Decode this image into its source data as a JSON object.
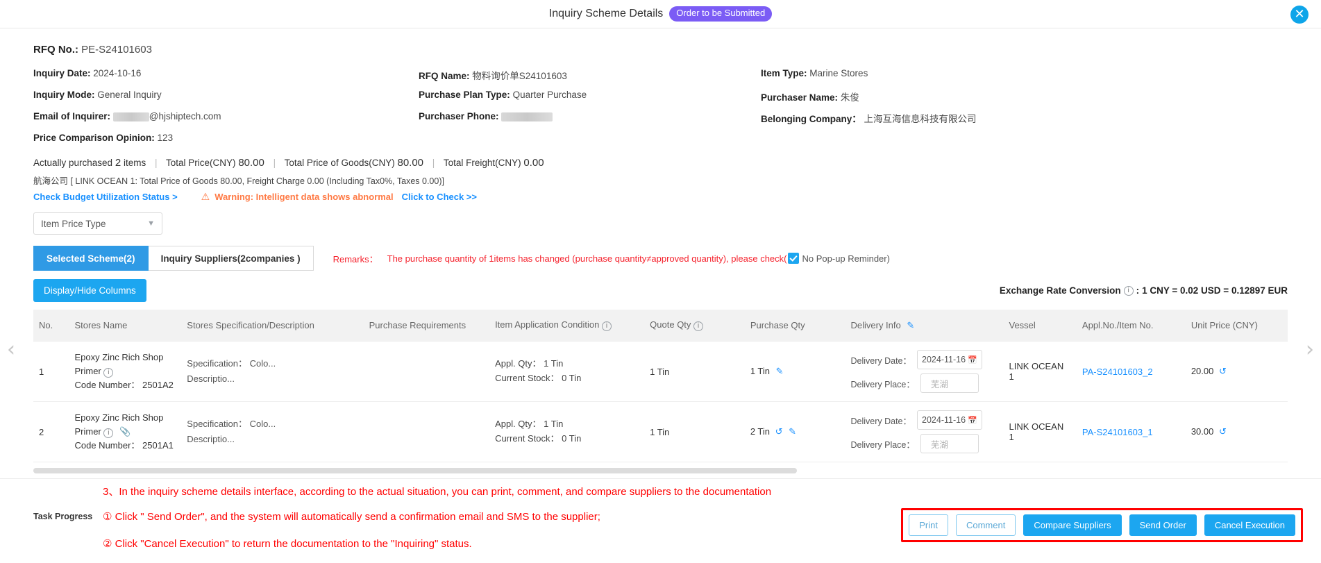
{
  "titlebar": {
    "title": "Inquiry Scheme Details",
    "status": "Order to be Submitted",
    "close": "✕"
  },
  "header": {
    "rfq_no_label": "RFQ No.:",
    "rfq_no_value": "PE-S24101603",
    "fields": [
      {
        "label": "Inquiry Date:",
        "value": "2024-10-16"
      },
      {
        "label": "RFQ Name:",
        "value": "物料询价单S24101603"
      },
      {
        "label": "Item Type:",
        "value": "Marine Stores"
      },
      {
        "label": "Inquiry Mode:",
        "value": "General Inquiry"
      },
      {
        "label": "Purchase Plan Type:",
        "value": "Quarter Purchase"
      },
      {
        "label": "Purchaser Name:",
        "value": "朱俊"
      },
      {
        "label": "Email of Inquirer:",
        "value": "@hjshiptech.com"
      },
      {
        "label": "Purchaser Phone:",
        "value": ""
      },
      {
        "label": "Belonging Company：",
        "value": "上海互海信息科技有限公司"
      },
      {
        "label": "Price Comparison Opinion:",
        "value": "123"
      }
    ]
  },
  "summary": {
    "purchased_prefix": "Actually purchased",
    "purchased_count": "2",
    "purchased_suffix": "items",
    "total_price_label": "Total Price(CNY)",
    "total_price_value": "80.00",
    "total_goods_label": "Total Price of Goods(CNY)",
    "total_goods_value": "80.00",
    "total_freight_label": "Total Freight(CNY)",
    "total_freight_value": "0.00",
    "supplier_line": "航海公司 [ LINK OCEAN 1: Total Price of Goods 80.00, Freight Charge 0.00 (Including Tax0%, Taxes 0.00)]",
    "budget_link": "Check Budget Utilization Status >",
    "warning_text": "Warning: Intelligent data shows abnormal",
    "warning_link": "Click to Check >>",
    "warning_icon": "⚠"
  },
  "price_type_select": {
    "value": "Item Price Type",
    "chevron": "⌄"
  },
  "tabs": [
    {
      "label": "Selected Scheme(2)",
      "active": true
    },
    {
      "label": "Inquiry Suppliers(2companies )",
      "active": false
    }
  ],
  "remarks": {
    "label": "Remarks：",
    "text": "The purchase quantity of 1items has changed (purchase quantity≠approved quantity), please check(",
    "checkbox_label": "No Pop-up Reminder)",
    "checked": true
  },
  "subbar": {
    "display_hide_columns": "Display/Hide Columns",
    "exchange_label": "Exchange Rate Conversion",
    "exchange_value": "1 CNY = 0.02 USD = 0.12897 EUR"
  },
  "table": {
    "headers": [
      "No.",
      "Stores Name",
      "Stores Specification/Description",
      "Purchase Requirements",
      "Item Application Condition",
      "Quote Qty",
      "Purchase Qty",
      "Delivery Info",
      "Vessel",
      "Appl.No./Item No.",
      "Unit Price (CNY)"
    ],
    "rows": [
      {
        "no": "1",
        "name": "Epoxy Zinc Rich Shop Primer",
        "code_label": "Code Number：",
        "code_value": "2501A2",
        "has_attachment": false,
        "spec": "Specification： Colo...",
        "desc": "Descriptio...",
        "requirements": "",
        "appl_qty_label": "Appl. Qty：",
        "appl_qty_value": "1 Tin",
        "stock_label": "Current Stock：",
        "stock_value": "0 Tin",
        "quote_qty": "1 Tin",
        "purchase_qty": "1 Tin",
        "purchase_qty_has_undo": false,
        "delivery_date_label": "Delivery Date：",
        "delivery_date": "2024-11-16",
        "delivery_place_label": "Delivery Place：",
        "delivery_place": "芜湖",
        "vessel": "LINK OCEAN 1",
        "appl_no": "PA-S24101603_2",
        "unit_price": "20.00"
      },
      {
        "no": "2",
        "name": "Epoxy Zinc Rich Shop Primer",
        "code_label": "Code Number：",
        "code_value": "2501A1",
        "has_attachment": true,
        "spec": "Specification： Colo...",
        "desc": "Descriptio...",
        "requirements": "",
        "appl_qty_label": "Appl. Qty：",
        "appl_qty_value": "1 Tin",
        "stock_label": "Current Stock：",
        "stock_value": "0 Tin",
        "quote_qty": "1 Tin",
        "purchase_qty": "2 Tin",
        "purchase_qty_has_undo": true,
        "delivery_date_label": "Delivery Date：",
        "delivery_date": "2024-11-16",
        "delivery_place_label": "Delivery Place：",
        "delivery_place": "芜湖",
        "vessel": "LINK OCEAN 1",
        "appl_no": "PA-S24101603_1",
        "unit_price": "30.00"
      }
    ]
  },
  "footer": {
    "task_progress_label": "Task Progress",
    "buttons": [
      {
        "label": "Print",
        "style": "ghost"
      },
      {
        "label": "Comment",
        "style": "ghost"
      },
      {
        "label": "Compare Suppliers",
        "style": "primary"
      },
      {
        "label": "Send Order",
        "style": "primary"
      },
      {
        "label": "Cancel Execution",
        "style": "primary"
      }
    ]
  },
  "annotations": {
    "line1": "3、In the inquiry scheme details interface, according to the actual situation, you can print, comment, and compare suppliers to the documentation",
    "line2": "① Click \" Send Order\", and the system will automatically send a confirmation email and SMS to the supplier;",
    "line3": "② Click \"Cancel Execution\" to return the documentation to the \"Inquiring\" status."
  },
  "nav": {
    "prev": "‹",
    "next": "›"
  }
}
